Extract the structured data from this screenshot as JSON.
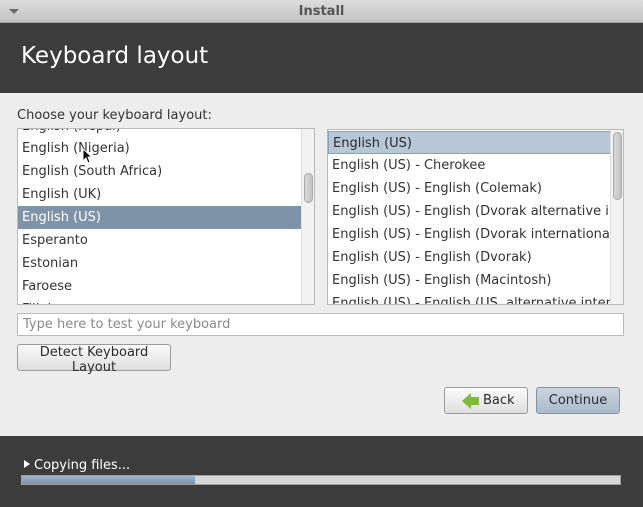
{
  "window": {
    "title": "Install"
  },
  "header": {
    "title": "Keyboard layout"
  },
  "prompt": "Choose your keyboard layout:",
  "left_list": {
    "items": [
      {
        "label": "English (Nigeria)"
      },
      {
        "label": "English (South Africa)"
      },
      {
        "label": "English (UK)"
      },
      {
        "label": "English (US)",
        "selected": true
      },
      {
        "label": "Esperanto"
      },
      {
        "label": "Estonian"
      },
      {
        "label": "Faroese"
      }
    ],
    "scroll_position": 0.3
  },
  "right_list": {
    "items": [
      {
        "label": "English (US)",
        "selected": true
      },
      {
        "label": "English (US) - Cherokee"
      },
      {
        "label": "English (US) - English (Colemak)"
      },
      {
        "label": "English (US) - English (Dvorak alternative international no dead keys)"
      },
      {
        "label": "English (US) - English (Dvorak international with dead keys)"
      },
      {
        "label": "English (US) - English (Dvorak)"
      },
      {
        "label": "English (US) - English (Macintosh)"
      },
      {
        "label": "English (US) - English (US, alternative international)"
      }
    ],
    "scroll_position": 0.0
  },
  "test_input": {
    "placeholder": "Type here to test your keyboard",
    "value": ""
  },
  "buttons": {
    "detect": "Detect Keyboard Layout",
    "back": "Back",
    "continue": "Continue"
  },
  "footer": {
    "status": "Copying files...",
    "progress": 0.29
  },
  "colors": {
    "header_bg": "#3c3c3c",
    "selection": "#7f93a8",
    "progress_fill": "#8ea2b8",
    "back_arrow": "#7fb93a"
  },
  "icons": {
    "back": "arrow-left-icon",
    "expander": "triangle-right-icon",
    "window_menu": "chevron-down-icon"
  }
}
